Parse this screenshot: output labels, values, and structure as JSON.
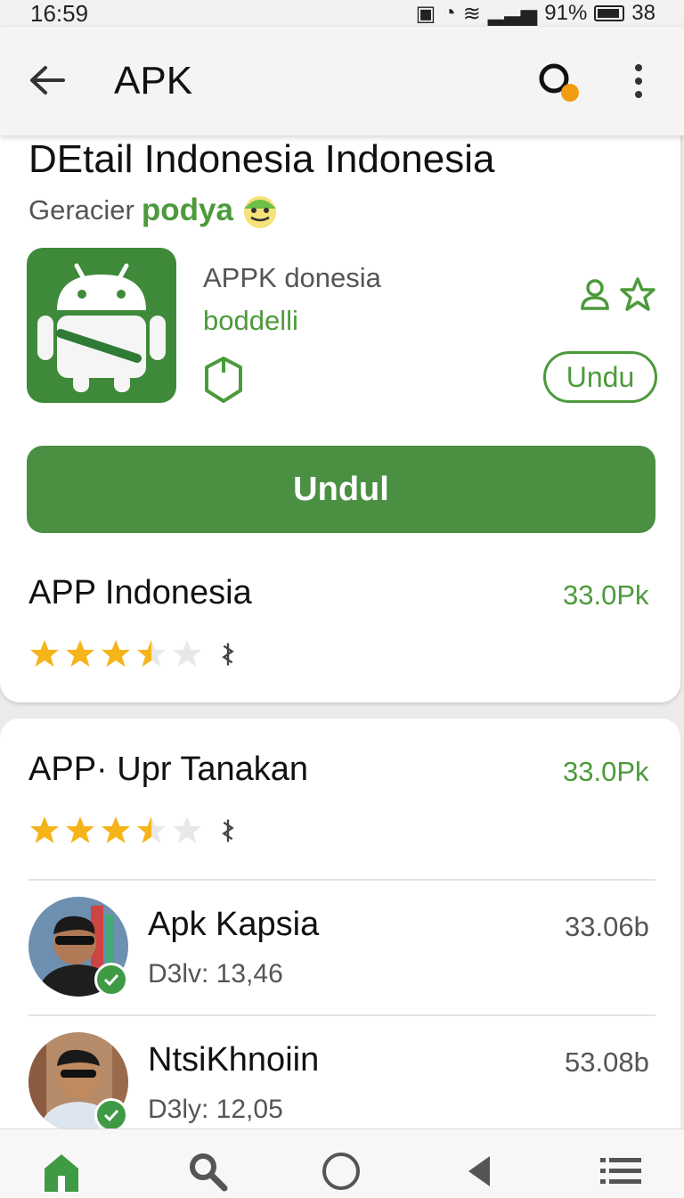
{
  "status_bar": {
    "time": "16:59",
    "battery": "91%",
    "signal_text": "38"
  },
  "app_bar": {
    "title": "APK"
  },
  "detail": {
    "title": "DEtail Indonesia Indonesia",
    "sub_label": "Geracier",
    "sub_brand": "podya",
    "app_name": "APPK donesia",
    "developer": "boddelli",
    "pill_button": "Undu",
    "main_button": "Undul"
  },
  "rows": [
    {
      "title": "APP Indonesia",
      "count": "33.0Pk",
      "rating": 3.5
    },
    {
      "title": "APP· Upr Tanakan",
      "count": "33.0Pk",
      "rating": 3.5
    }
  ],
  "people": [
    {
      "name": "Apk Kapsia",
      "meta": "D3lv: 13,46",
      "count": "33.06b"
    },
    {
      "name": "NtsiKhnoiin",
      "meta": "D3ly: 12,05",
      "count": "53.08b"
    }
  ],
  "colors": {
    "accent": "#4c9a3b",
    "button": "#4b8f43",
    "star": "#f5b41a"
  },
  "icons": [
    "back-arrow-icon",
    "search-icon",
    "more-vert-icon",
    "android-icon",
    "shield-icon",
    "user-icon",
    "star-outline-icon",
    "star-icon",
    "share-icon",
    "verified-icon",
    "home-icon",
    "circle-icon",
    "back-triangle-icon",
    "menu-icon"
  ]
}
